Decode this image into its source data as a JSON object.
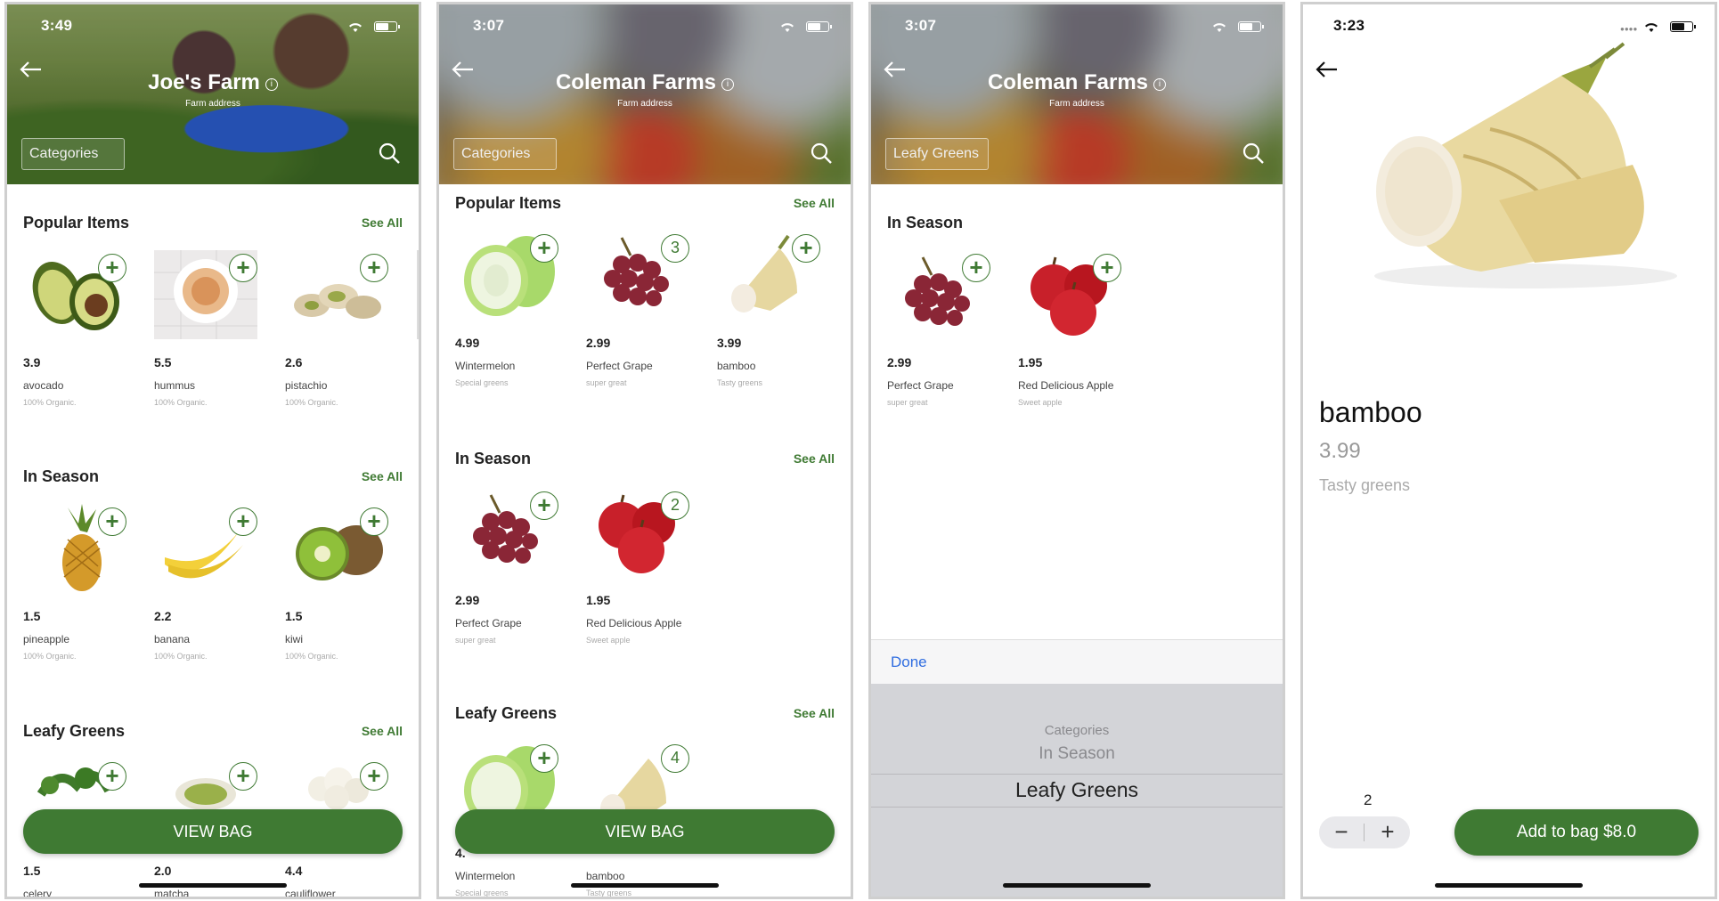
{
  "colors": {
    "brand_green": "#3f7a33",
    "ios_blue": "#2f6de0"
  },
  "screen1": {
    "status_time": "3:49",
    "farm_name": "Joe's Farm",
    "farm_subtitle": "Farm address",
    "categories_label": "Categories",
    "sections": [
      {
        "title": "Popular Items",
        "see_all": "See All",
        "items": [
          {
            "price": "3.9",
            "name": "avocado",
            "desc": "100% Organic."
          },
          {
            "price": "5.5",
            "name": "hummus",
            "desc": "100% Organic."
          },
          {
            "price": "2.6",
            "name": "pistachio",
            "desc": "100% Organic."
          }
        ]
      },
      {
        "title": "In Season",
        "see_all": "See All",
        "items": [
          {
            "price": "1.5",
            "name": "pineapple",
            "desc": "100% Organic."
          },
          {
            "price": "2.2",
            "name": "banana",
            "desc": "100% Organic."
          },
          {
            "price": "1.5",
            "name": "kiwi",
            "desc": "100% Organic."
          }
        ]
      },
      {
        "title": "Leafy Greens",
        "see_all": "See All",
        "items": [
          {
            "price": "1.5",
            "name": "celery",
            "desc": ""
          },
          {
            "price": "2.0",
            "name": "matcha",
            "desc": ""
          },
          {
            "price": "4.4",
            "name": "cauliflower",
            "desc": ""
          }
        ]
      }
    ],
    "view_bag": "VIEW BAG"
  },
  "screen2": {
    "status_time": "3:07",
    "farm_name": "Coleman Farms",
    "farm_subtitle": "Farm address",
    "categories_label": "Categories",
    "sections": [
      {
        "title": "Popular Items",
        "see_all": "See All",
        "items": [
          {
            "price": "4.99",
            "name": "Wintermelon",
            "desc": "Special greens",
            "count": ""
          },
          {
            "price": "2.99",
            "name": "Perfect Grape",
            "desc": "super great",
            "count": "3"
          },
          {
            "price": "3.99",
            "name": "bamboo",
            "desc": "Tasty greens",
            "count": ""
          }
        ]
      },
      {
        "title": "In Season",
        "see_all": "See All",
        "items": [
          {
            "price": "2.99",
            "name": "Perfect Grape",
            "desc": "super great",
            "count": ""
          },
          {
            "price": "1.95",
            "name": "Red Delicious Apple",
            "desc": "Sweet apple",
            "count": "2"
          }
        ]
      },
      {
        "title": "Leafy Greens",
        "see_all": "See All",
        "items": [
          {
            "price": "4.",
            "name": "Wintermelon",
            "desc": "Special greens",
            "count": ""
          },
          {
            "price": "",
            "name": "bamboo",
            "desc": "Tasty greens",
            "count": "4"
          }
        ]
      }
    ],
    "view_bag": "VIEW BAG"
  },
  "screen3": {
    "status_time": "3:07",
    "farm_name": "Coleman Farms",
    "farm_subtitle": "Farm address",
    "categories_label": "Leafy Greens",
    "section": {
      "title": "In Season",
      "items": [
        {
          "price": "2.99",
          "name": "Perfect Grape",
          "desc": "super great"
        },
        {
          "price": "1.95",
          "name": "Red Delicious Apple",
          "desc": "Sweet apple"
        }
      ]
    },
    "done_label": "Done",
    "picker_options": [
      "Categories",
      "In Season",
      "Leafy Greens"
    ],
    "picker_selected": "Leafy Greens"
  },
  "screen4": {
    "status_time": "3:23",
    "product_name": "bamboo",
    "product_price": "3.99",
    "product_desc": "Tasty greens",
    "quantity": "2",
    "minus_label": "−",
    "plus_label": "+",
    "add_to_bag": "Add to bag $8.0"
  }
}
